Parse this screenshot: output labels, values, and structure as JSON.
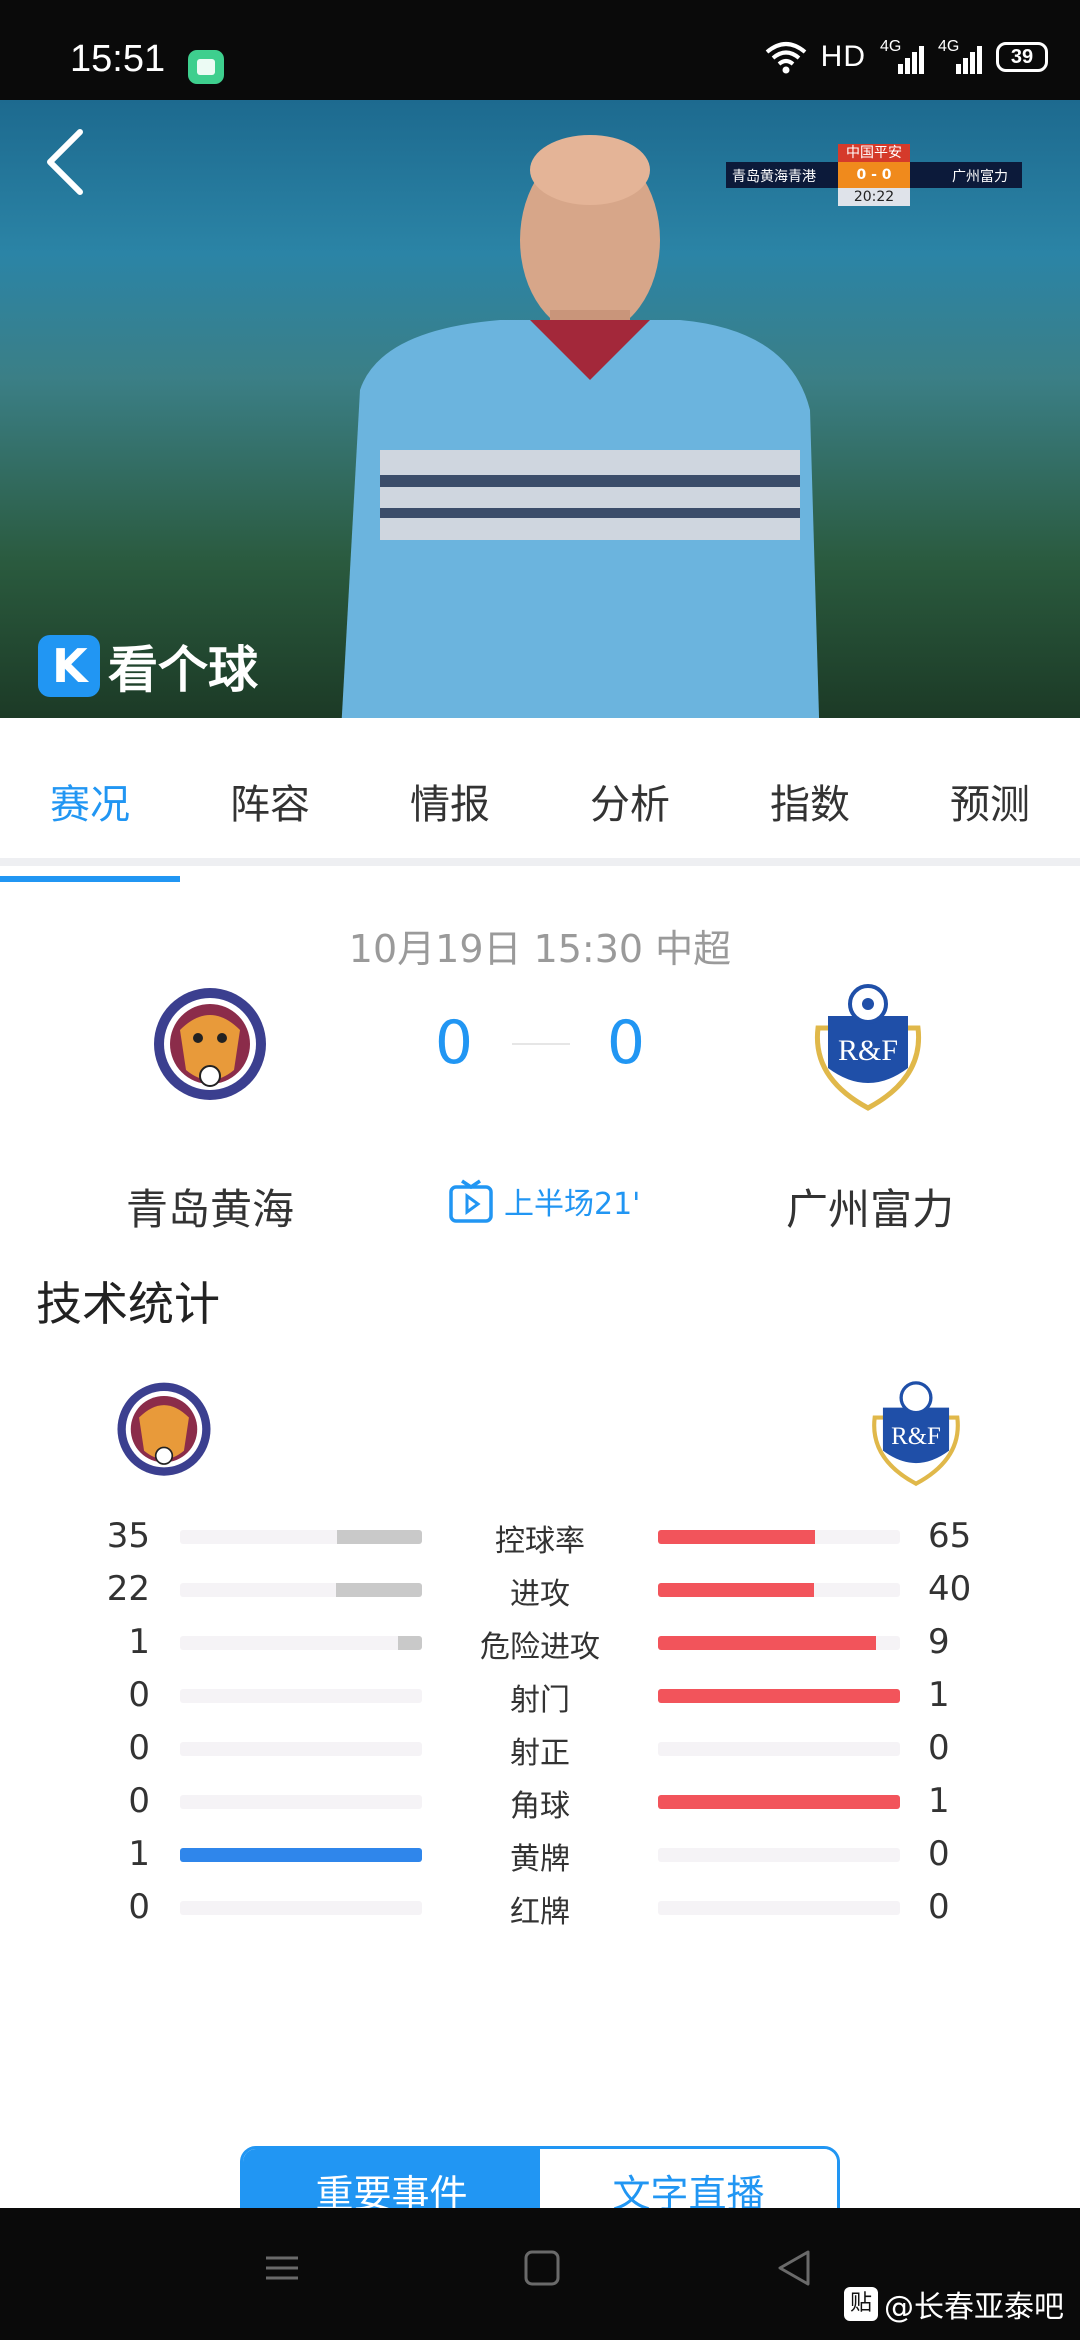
{
  "status_bar": {
    "time": "15:51",
    "hd": "HD",
    "network1": "4G",
    "network2": "4G",
    "battery": "39"
  },
  "video": {
    "scoreboard": {
      "sponsor": "中国平安",
      "home": "青岛黄海青港",
      "score": "0 - 0",
      "away": "广州富力",
      "clock": "20:22"
    },
    "watermark": "看个球"
  },
  "tabs": [
    {
      "label": "赛况",
      "active": true
    },
    {
      "label": "阵容",
      "active": false
    },
    {
      "label": "情报",
      "active": false
    },
    {
      "label": "分析",
      "active": false
    },
    {
      "label": "指数",
      "active": false
    },
    {
      "label": "预测",
      "active": false
    }
  ],
  "match": {
    "date": "10月19日 15:30 中超",
    "home_team": "青岛黄海",
    "away_team": "广州富力",
    "home_score": "0",
    "away_score": "0",
    "live_status": "上半场21'",
    "away_logo_text": "R&F"
  },
  "stats_section": {
    "title": "技术统计",
    "home_color": "#c9c9c9",
    "away_color": "#f2545b",
    "highlight_color": "#2f86eb",
    "rows": [
      {
        "name": "控球率",
        "home": 35,
        "away": 65
      },
      {
        "name": "进攻",
        "home": 22,
        "away": 40
      },
      {
        "name": "危险进攻",
        "home": 1,
        "away": 9
      },
      {
        "name": "射门",
        "home": 0,
        "away": 1
      },
      {
        "name": "射正",
        "home": 0,
        "away": 0
      },
      {
        "name": "角球",
        "home": 0,
        "away": 1
      },
      {
        "name": "黄牌",
        "home": 1,
        "away": 0
      },
      {
        "name": "红牌",
        "home": 0,
        "away": 0
      }
    ]
  },
  "bottom_buttons": {
    "events": "重要事件",
    "text_live": "文字直播"
  },
  "watermark": {
    "badge": "贴",
    "text": "@长春亚泰吧"
  }
}
